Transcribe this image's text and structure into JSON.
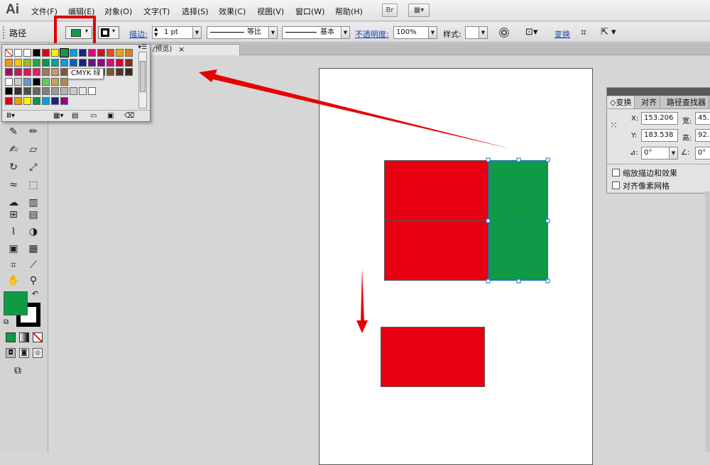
{
  "app": {
    "logo": "Ai"
  },
  "menu": [
    "文件(F)",
    "编辑(E)",
    "对象(O)",
    "文字(T)",
    "选择(S)",
    "效果(C)",
    "视图(V)",
    "窗口(W)",
    "帮助(H)"
  ],
  "menu_buttons": [
    "Br",
    "▦▾"
  ],
  "control": {
    "object_type": "路径",
    "fill_color": "#0f9a47",
    "stroke_label": "描边:",
    "stroke_weight": "1 pt",
    "profile": "等比",
    "brush": "基本",
    "opacity_label": "不透明度:",
    "opacity": "100%",
    "style_label": "样式:",
    "transform_link": "变换"
  },
  "doc_tab": {
    "label": "/预览)",
    "close": "×"
  },
  "swatch_panel": {
    "tooltip": "CMYK 绿",
    "rows": [
      [
        "#ffffff",
        "#ffffff",
        "#ffffff",
        "#000000",
        "#e60012",
        "#fff100",
        "#0f9a47",
        "#00a0e9",
        "#1d2088",
        "#e4007f",
        "#c8161d",
        "#e5511f",
        "#f0a300",
        "#dd7d1b"
      ],
      [
        "#f39800",
        "#fcc800",
        "#8fc31f",
        "#22ac38",
        "#009944",
        "#00a29a",
        "#00a0e9",
        "#0068b7",
        "#1d2088",
        "#601986",
        "#920783",
        "#e4007f",
        "#d7003a",
        "#8a2b1e"
      ],
      [
        "#a40b5d",
        "#c2185b",
        "#d81b60",
        "#e91e63",
        "#9e7a5a",
        "#c19a6b",
        "#7b5a3a",
        "#a0522d",
        "#6b4423",
        "#8b6914",
        "#5c3d1e",
        "#7f5539",
        "#4e342e",
        "#3e2723"
      ],
      [
        "#ffffff",
        "#cccccc",
        "#6699cc",
        "#000000",
        "#66cc66",
        "#c8a060",
        "#b08850"
      ],
      [
        "#000000",
        "#333333",
        "#4d4d4d",
        "#666666",
        "#808080",
        "#999999",
        "#b3b3b3",
        "#cccccc",
        "#e6e6e6",
        "#ffffff"
      ],
      [
        "#e60012",
        "#f39800",
        "#fff100",
        "#009944",
        "#00a0e9",
        "#1d2088",
        "#920783"
      ]
    ]
  },
  "artwork": {
    "red": "#e60012",
    "green": "#0f9a47"
  },
  "transform_panel": {
    "tabs": [
      "◇变换",
      "对齐",
      "路径查找器"
    ],
    "x_label": "X:",
    "x": "153.206",
    "w_label": "宽:",
    "w": "45.",
    "y_label": "Y:",
    "y": "183.538",
    "h_label": "高:",
    "h": "92.",
    "angle": "0°",
    "shear": "0°",
    "opt1": "缩放描边和效果",
    "opt2": "对齐像素网格"
  },
  "toolbox": {
    "fill": "#0f9a47",
    "stroke": "#000000"
  }
}
